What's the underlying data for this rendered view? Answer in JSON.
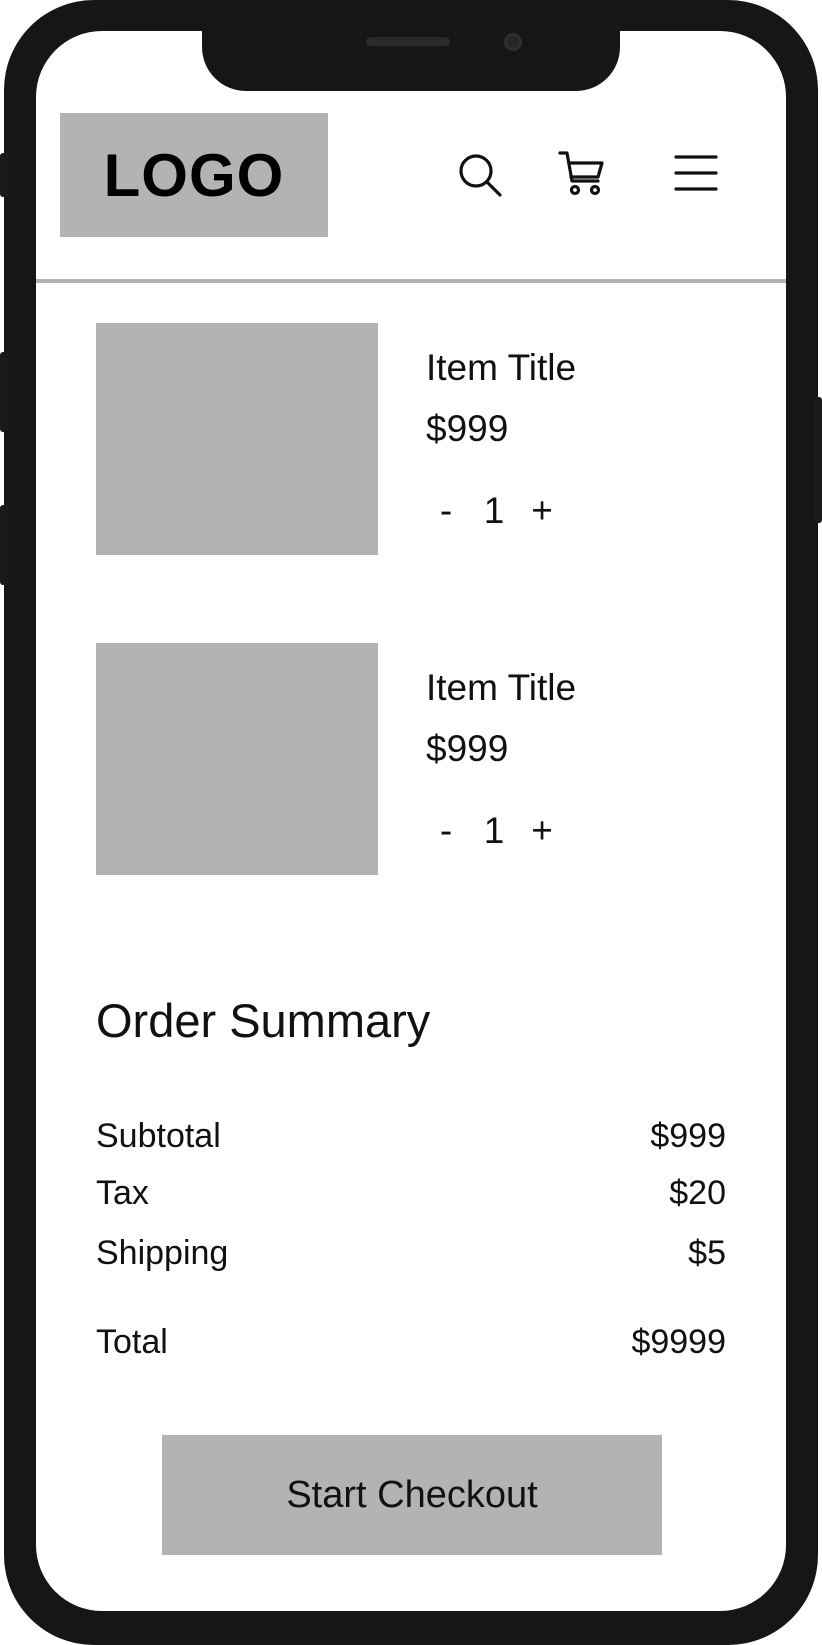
{
  "header": {
    "logo_text": "LOGO",
    "icons": [
      "search-icon",
      "cart-icon",
      "menu-icon"
    ]
  },
  "cart": {
    "items": [
      {
        "title": "Item Title",
        "price": "$999",
        "qty_minus": "-",
        "qty": "1",
        "qty_plus": "+"
      },
      {
        "title": "Item Title",
        "price": "$999",
        "qty_minus": "-",
        "qty": "1",
        "qty_plus": "+"
      }
    ]
  },
  "summary": {
    "title": "Order Summary",
    "subtotal_label": "Subtotal",
    "subtotal_value": "$999",
    "tax_label": "Tax",
    "tax_value": "$20",
    "shipping_label": "Shipping",
    "shipping_value": "$5",
    "total_label": "Total",
    "total_value": "$9999"
  },
  "checkout": {
    "label": "Start Checkout"
  },
  "colors": {
    "placeholder_gray": "#b3b3b3",
    "device_frame": "#161616",
    "text": "#111111"
  }
}
